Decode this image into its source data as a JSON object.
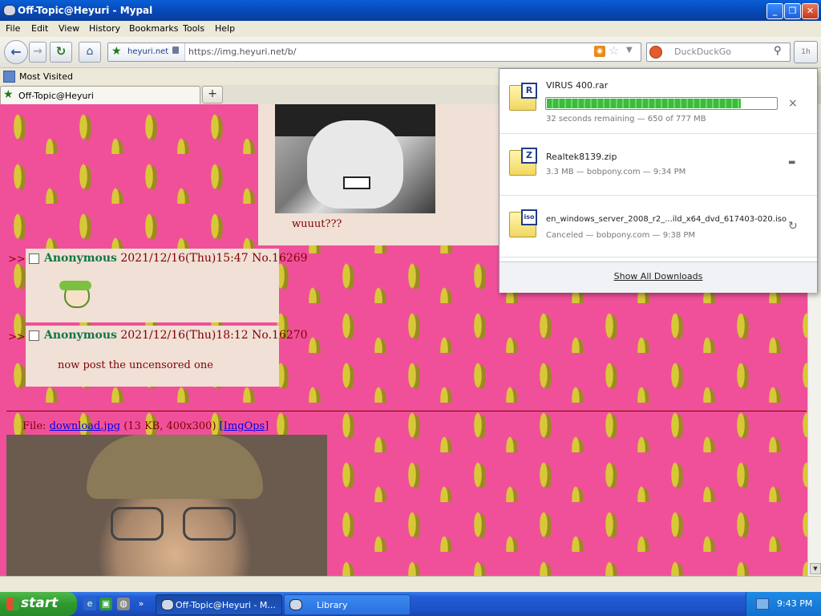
{
  "window": {
    "title": "Off-Topic@Heyuri - Mypal"
  },
  "menu": [
    "File",
    "Edit",
    "View",
    "History",
    "Bookmarks",
    "Tools",
    "Help"
  ],
  "nav": {
    "identity_domain": "heyuri.net",
    "url": "https://img.heyuri.net/b/",
    "search_placeholder": "DuckDuckGo",
    "downloads_button": "1h"
  },
  "bookmarks_bar": {
    "item": "Most Visited"
  },
  "tabs": [
    {
      "label": "Off-Topic@Heyuri"
    }
  ],
  "posts": [
    {
      "caption": "wuuut???"
    },
    {
      "arrows": ">>",
      "name": "Anonymous",
      "date": "2021/12/16(Thu)15:47",
      "no": "No.16269"
    },
    {
      "arrows": ">>",
      "name": "Anonymous",
      "date": "2021/12/16(Thu)18:12",
      "no": "No.16270",
      "message": "now post the uncensored one"
    }
  ],
  "thread": {
    "file_label": "File:",
    "file_name": "download.jpg",
    "file_info": "(13 KB, 400x300)",
    "imgops": "[ImgOps]"
  },
  "downloads": {
    "items": [
      {
        "name": "VIRUS 400.rar",
        "tag": "R",
        "status": "32 seconds remaining — 650 of 777 MB",
        "progress": 0.84,
        "action": "×"
      },
      {
        "name": "Realtek8139.zip",
        "tag": "Z",
        "status": "3.3 MB — bobpony.com — 9:34 PM",
        "action": "▬"
      },
      {
        "name": "en_windows_server_2008_r2_...ild_x64_dvd_617403-020.iso",
        "tag": "iso",
        "status": "Canceled — bobpony.com — 9:38 PM",
        "action": "↻"
      }
    ],
    "show_all": "Show All Downloads"
  },
  "taskbar": {
    "start": "start",
    "tasks": [
      {
        "label": "Off-Topic@Heyuri - M..."
      },
      {
        "label": "Library"
      }
    ],
    "clock": "9:43 PM"
  },
  "colors": {
    "accent": "#0a5fd6",
    "board_bg": "#f0509a",
    "post_bg": "#f0e0d6",
    "name": "#117743"
  }
}
